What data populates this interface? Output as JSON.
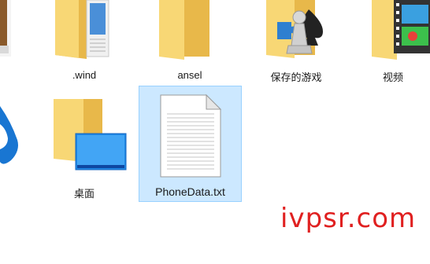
{
  "items": [
    {
      "id": "wind",
      "label": ".wind"
    },
    {
      "id": "ansel",
      "label": "ansel"
    },
    {
      "id": "saved-games",
      "label": "保存的游戏"
    },
    {
      "id": "videos",
      "label": "视频"
    },
    {
      "id": "desktop",
      "label": "桌面"
    },
    {
      "id": "phonedata",
      "label": "PhoneData.txt",
      "selected": true
    }
  ],
  "watermark": "ivpsr.com",
  "colors": {
    "folder_back": "#e8b84a",
    "folder_front": "#f8d775",
    "selection_bg": "#cce8ff",
    "selection_border": "#99d1ff",
    "watermark": "#e02020"
  }
}
